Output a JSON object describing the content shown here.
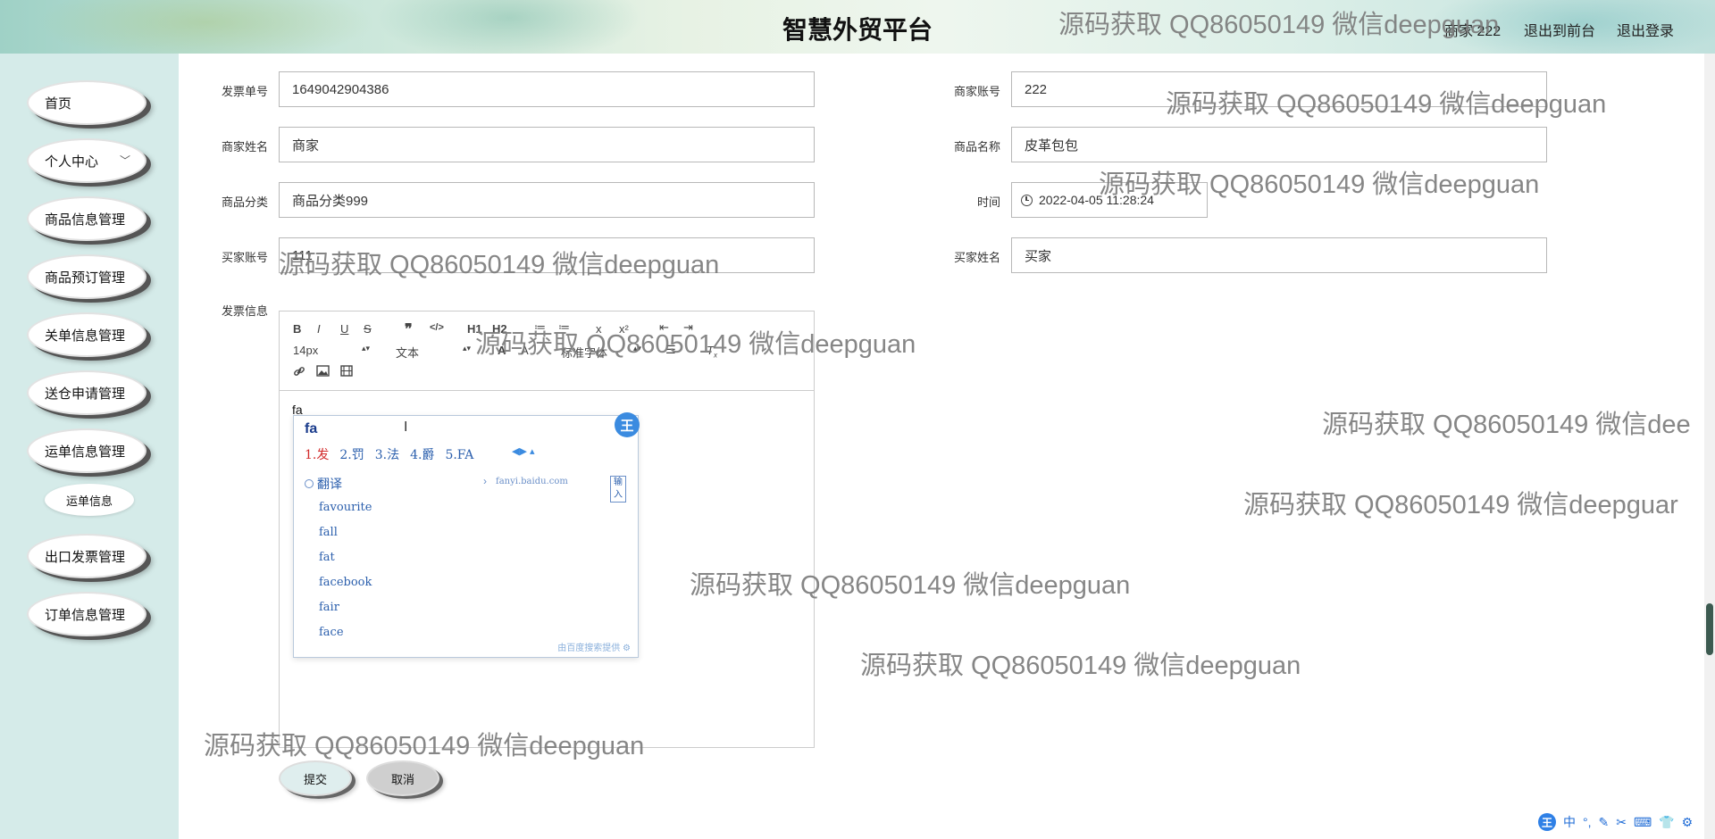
{
  "header": {
    "title": "智慧外贸平台",
    "user_info": "商家 222",
    "link_frontend": "退出到前台",
    "link_logout": "退出登录"
  },
  "sidebar": {
    "items": [
      {
        "label": "首页"
      },
      {
        "label": "个人中心",
        "icon": "chevron-down-icon"
      },
      {
        "label": "商品信息管理"
      },
      {
        "label": "商品预订管理"
      },
      {
        "label": "关单信息管理"
      },
      {
        "label": "送仓申请管理"
      },
      {
        "label": "运单信息管理"
      },
      {
        "label": "运单信息",
        "sub": true
      },
      {
        "label": "出口发票管理"
      },
      {
        "label": "订单信息管理"
      }
    ]
  },
  "form": {
    "invoice_no": {
      "label": "发票单号",
      "value": "1649042904386"
    },
    "merchant_account": {
      "label": "商家账号",
      "value": "222"
    },
    "merchant_name": {
      "label": "商家姓名",
      "value": "商家"
    },
    "product_name": {
      "label": "商品名称",
      "value": "皮革包包"
    },
    "product_category": {
      "label": "商品分类",
      "value": "商品分类999"
    },
    "time": {
      "label": "时间",
      "value": "2022-04-05 11:28:24",
      "icon": "clock-icon"
    },
    "buyer_account": {
      "label": "买家账号",
      "value": "111"
    },
    "buyer_name": {
      "label": "买家姓名",
      "value": "买家"
    },
    "invoice_info": {
      "label": "发票信息"
    }
  },
  "editor": {
    "toolbar_row1": [
      "B",
      "I",
      "U",
      "S",
      "❞",
      "</>",
      "H1",
      "H2",
      "≔",
      "≔",
      "x",
      "x²",
      "⇤",
      "⇥"
    ],
    "font_size": "14px",
    "heading": "文本",
    "font_family": "标准字体",
    "toolbar_row3_icons": [
      "link-icon",
      "image-icon",
      "video-icon"
    ],
    "content": "fa"
  },
  "ime": {
    "composition": "fa",
    "candidates": [
      "1.发",
      "2.罚",
      "3.法",
      "4.爵",
      "5.FA"
    ],
    "translate_label": "翻译",
    "translate_url": "fanyi.baidu.com",
    "translate_button": "输入",
    "suggestions": [
      "favourite",
      "fall",
      "fat",
      "facebook",
      "fair",
      "face"
    ],
    "footer": "由百度搜索提供",
    "logo": "王"
  },
  "actions": {
    "submit": "提交",
    "cancel": "取消"
  },
  "watermark": {
    "text": "源码获取 QQ86050149 微信deepguan",
    "text_clipped": "源码获取 QQ86050149 微信dee",
    "text_clipped2": "源码获取 QQ86050149 微信deepguar"
  },
  "tray": {
    "logo": "王",
    "lang": "中"
  }
}
